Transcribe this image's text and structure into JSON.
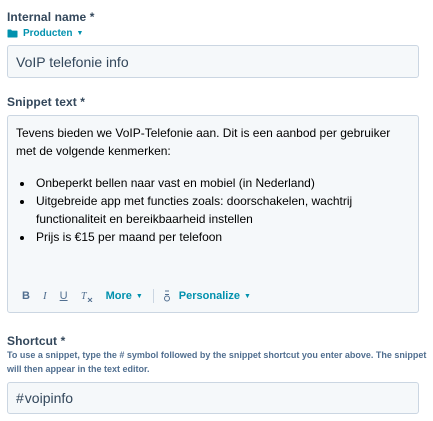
{
  "internal_name": {
    "label": "Internal name *",
    "folder": {
      "icon": "folder-icon",
      "label": "Producten"
    },
    "value": "VoIP telefonie info"
  },
  "snippet_text": {
    "label": "Snippet text *",
    "intro": "Tevens bieden we VoIP-Telefonie aan. Dit is een aanbod per gebruiker met de volgende kenmerken:",
    "bullets": [
      "Onbeperkt bellen naar vast en mobiel (in Nederland)",
      "Uitgebreide app met functies zoals: doorschakelen, wachtrij functionaliteit en bereikbaarheid instellen",
      "Prijs is €15 per maand per telefoon"
    ],
    "toolbar": {
      "bold": "B",
      "italic": "I",
      "underline": "U",
      "clear_format_icon": "clear-format-icon",
      "more": "More",
      "personalize_icon": "personalize-icon",
      "personalize": "Personalize"
    }
  },
  "shortcut": {
    "label": "Shortcut *",
    "help": "To use a snippet, type the # symbol followed by the snippet shortcut you enter above. The snippet will then appear in the text editor.",
    "prefix": "#",
    "value": "voipinfo"
  },
  "colors": {
    "label": "#33475b",
    "link": "#0091ae",
    "input_bg": "#f5f8fa",
    "input_border": "#cbd6e2"
  }
}
